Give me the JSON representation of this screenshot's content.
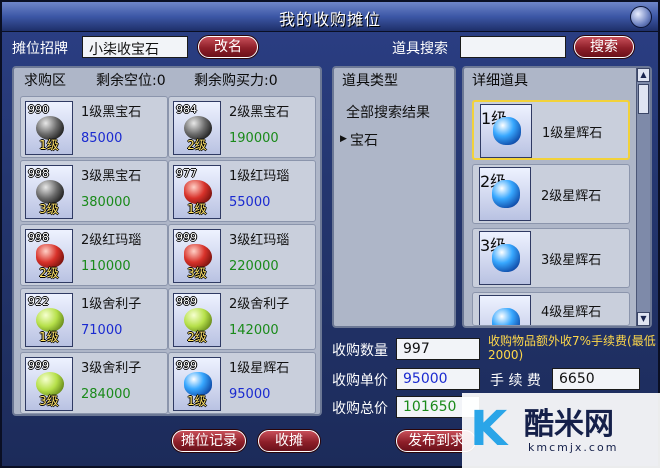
{
  "window": {
    "title": "我的收购摊位"
  },
  "header": {
    "stall_sign_label": "摊位招牌",
    "stall_name_value": "小柒收宝石",
    "rename_button": "改名",
    "item_search_label": "道具搜索",
    "search_value": "",
    "search_button": "搜索"
  },
  "purchase_area": {
    "title": "求购区",
    "remaining_slots": "剩余空位:0",
    "remaining_power": "剩余购买力:0",
    "items": [
      {
        "qty": "990",
        "level": "1级",
        "name": "1级黑宝石",
        "price": "85000",
        "gem": "black",
        "price_color": "#1a2ad0"
      },
      {
        "qty": "984",
        "level": "2级",
        "name": "2级黑宝石",
        "price": "190000",
        "gem": "black",
        "price_color": "#1a8a1a"
      },
      {
        "qty": "998",
        "level": "3级",
        "name": "3级黑宝石",
        "price": "380000",
        "gem": "black",
        "price_color": "#1a8a1a"
      },
      {
        "qty": "977",
        "level": "1级",
        "name": "1级红玛瑙",
        "price": "55000",
        "gem": "red",
        "price_color": "#1a2ad0"
      },
      {
        "qty": "998",
        "level": "2级",
        "name": "2级红玛瑙",
        "price": "110000",
        "gem": "red",
        "price_color": "#1a8a1a"
      },
      {
        "qty": "999",
        "level": "3级",
        "name": "3级红玛瑙",
        "price": "220000",
        "gem": "red",
        "price_color": "#1a8a1a"
      },
      {
        "qty": "922",
        "level": "1级",
        "name": "1级舍利子",
        "price": "71000",
        "gem": "green",
        "price_color": "#1a2ad0"
      },
      {
        "qty": "989",
        "level": "2级",
        "name": "2级舍利子",
        "price": "142000",
        "gem": "green",
        "price_color": "#1a8a1a"
      },
      {
        "qty": "999",
        "level": "3级",
        "name": "3级舍利子",
        "price": "284000",
        "gem": "green",
        "price_color": "#1a8a1a"
      },
      {
        "qty": "999",
        "level": "1级",
        "name": "1级星辉石",
        "price": "95000",
        "gem": "blue",
        "price_color": "#1a2ad0"
      }
    ]
  },
  "item_types": {
    "title": "道具类型",
    "items": [
      "全部搜索结果",
      "宝石"
    ]
  },
  "detail_items": {
    "title": "详细道具",
    "items": [
      {
        "level": "1级",
        "name": "1级星辉石"
      },
      {
        "level": "2级",
        "name": "2级星辉石"
      },
      {
        "level": "3级",
        "name": "3级星辉石"
      },
      {
        "level": "",
        "name": "4级星辉石"
      }
    ]
  },
  "purchase_form": {
    "qty_label": "收购数量",
    "qty_value": "997",
    "fee_notice": "收购物品额外收7%手续费(最低2000)",
    "unit_price_label": "收购单价",
    "unit_price_value": "95000",
    "fee_label": "手 续 费",
    "fee_value": "6650",
    "total_label": "收购总价",
    "total_value": "101650"
  },
  "footer": {
    "stall_record_button": "摊位记录",
    "close_stall_button": "收摊",
    "publish_button": "发布到求"
  },
  "watermark": {
    "text": "酷米网",
    "url": "kmcmjx.com"
  }
}
